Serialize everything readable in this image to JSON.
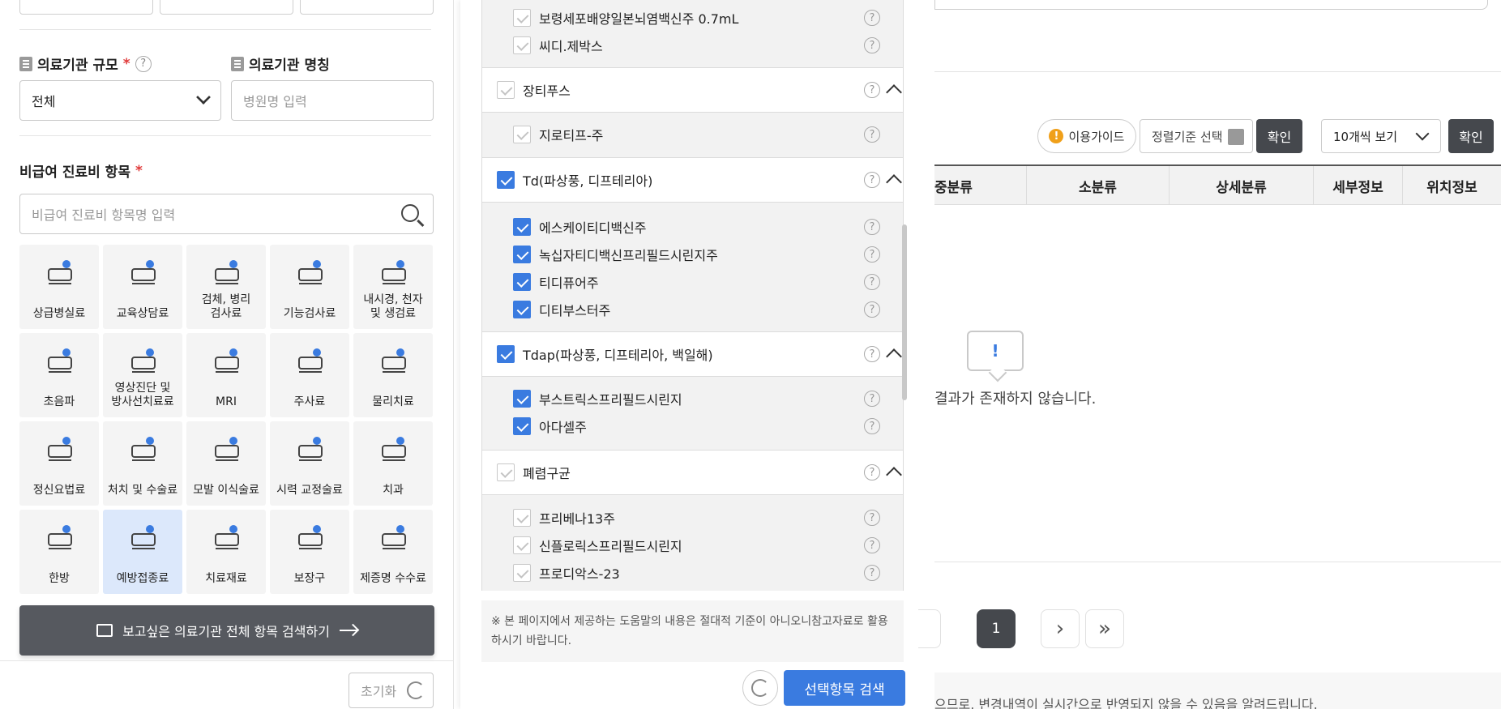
{
  "left": {
    "scale_label": "의료기관 규모",
    "scale_required": "*",
    "scale_help": "?",
    "scale_value": "전체",
    "name_label": "의료기관 명칭",
    "name_placeholder": "병원명 입력",
    "item_label": "비급여 진료비 항목",
    "item_required": "*",
    "item_placeholder": "비급여 진료비 항목명 입력",
    "categories": [
      {
        "label": "상급병실료",
        "icon": "hospital-bed-icon"
      },
      {
        "label": "교육상담료",
        "icon": "consultation-icon"
      },
      {
        "label": "검체, 병리\n검사료",
        "icon": "specimen-icon"
      },
      {
        "label": "기능검사료",
        "icon": "function-test-icon"
      },
      {
        "label": "내시경, 천자\n및 생검료",
        "icon": "endoscope-icon"
      },
      {
        "label": "초음파",
        "icon": "ultrasound-icon"
      },
      {
        "label": "영상진단 및\n방사선치료료",
        "icon": "xray-icon"
      },
      {
        "label": "MRI",
        "icon": "mri-icon"
      },
      {
        "label": "주사료",
        "icon": "syringe-icon"
      },
      {
        "label": "물리치료",
        "icon": "physio-icon"
      },
      {
        "label": "정신요법료",
        "icon": "brain-wave-icon"
      },
      {
        "label": "처치 및 수술료",
        "icon": "scalpel-icon"
      },
      {
        "label": "모발 이식술료",
        "icon": "hair-icon"
      },
      {
        "label": "시력 교정술료",
        "icon": "eye-icon"
      },
      {
        "label": "치과",
        "icon": "tooth-icon"
      },
      {
        "label": "한방",
        "icon": "ear-acupuncture-icon"
      },
      {
        "label": "예방접종료",
        "icon": "vaccine-icon",
        "active": true
      },
      {
        "label": "치료재료",
        "icon": "material-icon"
      },
      {
        "label": "보장구",
        "icon": "wheelchair-icon"
      },
      {
        "label": "제증명 수수료",
        "icon": "certificate-icon"
      }
    ],
    "search_all_label": "보고싶은 의료기관 전체 항목 검색하기",
    "reset_label": "초기화"
  },
  "middle": {
    "help_glyph": "?",
    "groups_top_items": [
      {
        "label": "보령세포배양일본뇌염백신주 0.7mL",
        "checked": false
      },
      {
        "label": "씨디.제박스",
        "checked": false
      }
    ],
    "group_typhoid": {
      "label": "장티푸스",
      "checked": false,
      "items": [
        {
          "label": "지로티프-주",
          "checked": false
        }
      ]
    },
    "group_td": {
      "label": "Td(파상풍, 디프테리아)",
      "checked": true,
      "items": [
        {
          "label": "에스케이티디백신주",
          "checked": true
        },
        {
          "label": "녹십자티디백신프리필드시린지주",
          "checked": true
        },
        {
          "label": "티디퓨어주",
          "checked": true
        },
        {
          "label": "디티부스터주",
          "checked": true
        }
      ]
    },
    "group_tdap": {
      "label": "Tdap(파상풍, 디프테리아, 백일해)",
      "checked": true,
      "items": [
        {
          "label": "부스트릭스프리필드시린지",
          "checked": true
        },
        {
          "label": "아다셀주",
          "checked": true
        }
      ]
    },
    "group_pneumo": {
      "label": "폐렴구균",
      "checked": false,
      "items": [
        {
          "label": "프리베나13주",
          "checked": false
        },
        {
          "label": "신플로릭스프리필드시린지",
          "checked": false
        },
        {
          "label": "프로디악스-23",
          "checked": false
        }
      ]
    },
    "notice": "※ 본 페이지에서 제공하는 도움말의 내용은 절대적 기준이 아니오니참고자료로 활용하시기 바랍니다.",
    "search_selected_label": "선택항목 검색"
  },
  "right": {
    "guide_label": "이용가이드",
    "sort_placeholder": "정렬기준 선택",
    "confirm_label": "확인",
    "view_value": "10개씩 보기",
    "columns": [
      "중분류",
      "소분류",
      "상세분류",
      "세부정보",
      "위치정보"
    ],
    "empty_mark": "!",
    "empty_text": "결과가 존재하지 않습니다.",
    "pagination": {
      "current": "1",
      "next": "›",
      "last": "»"
    },
    "footer_text": "으므로, 변경내역이 실시간으로 반영되지 않을 수 있음을 알려드립니다."
  },
  "colors": {
    "accent": "#3a7be0",
    "dark_button": "#45484d",
    "active_tile": "#dce8fb",
    "required": "#e03a3a"
  }
}
